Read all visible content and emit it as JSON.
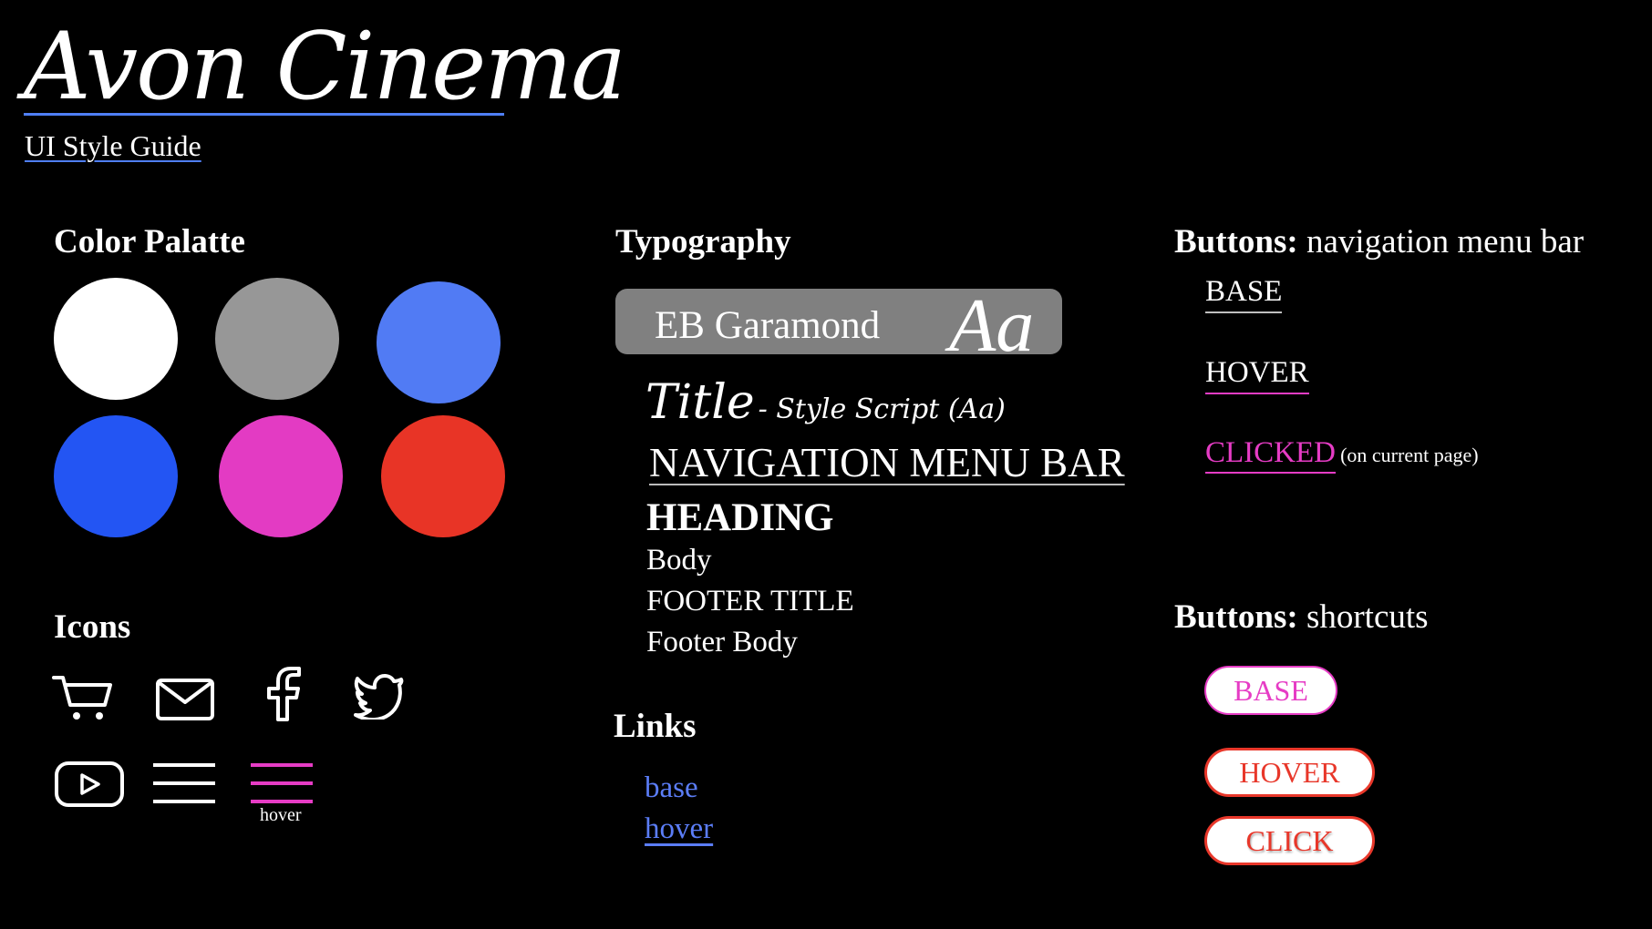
{
  "header": {
    "brand": "Avon Cinema",
    "subtitle": "UI Style Guide"
  },
  "colors": {
    "title": "Color Palatte",
    "swatches": [
      {
        "name": "white",
        "hex": "#ffffff"
      },
      {
        "name": "gray",
        "hex": "#979797"
      },
      {
        "name": "light-blue",
        "hex": "#517bf4"
      },
      {
        "name": "blue",
        "hex": "#2355f3"
      },
      {
        "name": "magenta",
        "hex": "#e33bc3"
      },
      {
        "name": "red",
        "hex": "#e83426"
      }
    ]
  },
  "icons": {
    "title": "Icons",
    "items": [
      "cart-icon",
      "mail-icon",
      "facebook-icon",
      "twitter-icon",
      "youtube-icon",
      "menu-icon",
      "menu-hover-icon"
    ],
    "hover_caption": "hover"
  },
  "typography": {
    "title": "Typography",
    "font_name": "EB Garamond",
    "font_sample": "Aa",
    "title_sample": "Title",
    "title_note": "- Style Script (Aa)",
    "nav_sample": "NAVIGATION MENU BAR",
    "heading_sample": "HEADING",
    "body_sample": "Body",
    "footer_title_sample": "FOOTER TITLE",
    "footer_body_sample": "Footer Body"
  },
  "links": {
    "title": "Links",
    "base": "base",
    "hover": "hover"
  },
  "nav_buttons": {
    "title_bold": "Buttons:",
    "title_rest": "navigation menu bar",
    "base": "BASE",
    "hover": "HOVER",
    "clicked": "CLICKED",
    "clicked_note": "(on current page)"
  },
  "shortcut_buttons": {
    "title_bold": "Buttons:",
    "title_rest": "shortcuts",
    "base": "BASE",
    "hover": "HOVER",
    "click": "CLICK"
  },
  "accent_colors": {
    "blue_underline": "#4f7ff5",
    "magenta": "#e63cc5",
    "red": "#e8372a",
    "link_blue": "#5b7df7"
  }
}
